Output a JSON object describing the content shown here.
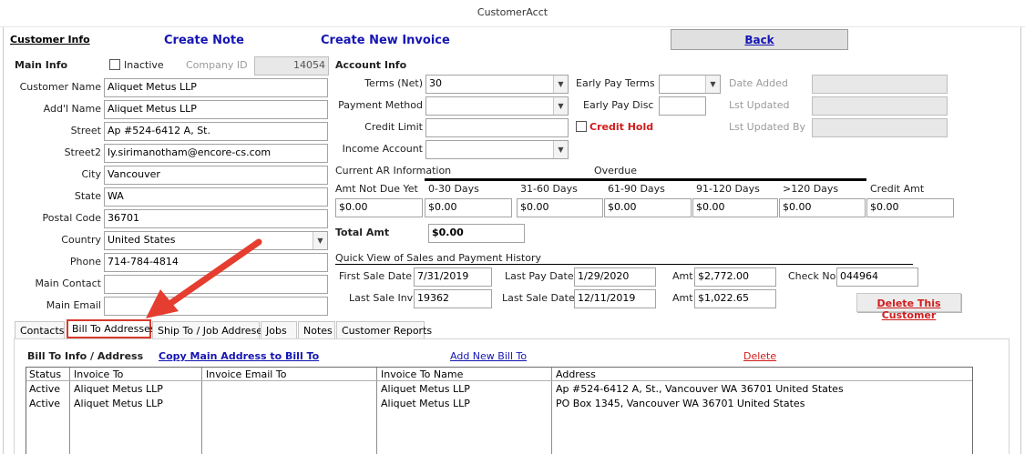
{
  "window": {
    "title": "CustomerAcct"
  },
  "header": {
    "customer_info": "Customer Info",
    "create_note": "Create Note",
    "create_invoice": "Create New Invoice",
    "back": "Back"
  },
  "main_info": {
    "heading": "Main Info",
    "inactive_label": "Inactive",
    "inactive_checked": false,
    "company_id_label": "Company ID",
    "company_id": "14054",
    "fields": [
      {
        "label": "Customer Name",
        "value": "Aliquet Metus LLP"
      },
      {
        "label": "Add'l Name",
        "value": "Aliquet Metus LLP"
      },
      {
        "label": "Street",
        "value": "Ap #524-6412 A, St."
      },
      {
        "label": "Street2",
        "value": "ly.sirimanotham@encore-cs.com"
      },
      {
        "label": "City",
        "value": "Vancouver"
      },
      {
        "label": "State",
        "value": "WA"
      },
      {
        "label": "Postal Code",
        "value": "36701"
      },
      {
        "label": "Country",
        "value": "United States"
      },
      {
        "label": "Phone",
        "value": "714-784-4814"
      },
      {
        "label": "Main Contact",
        "value": ""
      },
      {
        "label": "Main Email",
        "value": ""
      }
    ]
  },
  "account_info": {
    "heading": "Account Info",
    "terms_label": "Terms (Net)",
    "terms_value": "30",
    "payment_method_label": "Payment Method",
    "payment_method_value": "",
    "credit_limit_label": "Credit Limit",
    "credit_limit_value": "",
    "income_account_label": "Income Account",
    "income_account_value": "",
    "early_pay_terms_label": "Early Pay Terms",
    "early_pay_terms_value": "",
    "early_pay_disc_label": "Early Pay Disc",
    "early_pay_disc_value": "",
    "credit_hold_label": "Credit Hold",
    "credit_hold_checked": false,
    "date_added_label": "Date Added",
    "date_added_value": "",
    "lst_updated_label": "Lst Updated",
    "lst_updated_value": "",
    "lst_updated_by_label": "Lst Updated By",
    "lst_updated_by_value": ""
  },
  "ar": {
    "heading": "Current AR Information",
    "overdue_label": "Overdue",
    "columns": [
      "Amt Not Due Yet",
      "0-30 Days",
      "31-60 Days",
      "61-90 Days",
      "91-120 Days",
      ">120 Days",
      "Credit Amt"
    ],
    "values": [
      "$0.00",
      "$0.00",
      "$0.00",
      "$0.00",
      "$0.00",
      "$0.00",
      "$0.00"
    ],
    "total_label": "Total Amt",
    "total_value": "$0.00"
  },
  "history": {
    "heading": "Quick View of Sales and Payment History",
    "first_sale_date_label": "First Sale Date",
    "first_sale_date": "7/31/2019",
    "last_pay_date_label": "Last Pay Date",
    "last_pay_date": "1/29/2020",
    "amt_label_1": "Amt",
    "amt_1": "$2,772.00",
    "check_no_label": "Check No",
    "check_no": "044964",
    "last_sale_inv_label": "Last Sale Inv",
    "last_sale_inv": "19362",
    "last_sale_date_label": "Last Sale Date",
    "last_sale_date": "12/11/2019",
    "amt_label_2": "Amt",
    "amt_2": "$1,022.65",
    "delete_customer": "Delete This Customer"
  },
  "tabs": [
    {
      "label": "Contacts",
      "active": false
    },
    {
      "label": "Bill To Addresses",
      "active": true
    },
    {
      "label": "Ship To / Job Addreses",
      "active": false
    },
    {
      "label": "Jobs",
      "active": false
    },
    {
      "label": "Notes",
      "active": false
    },
    {
      "label": "Customer Reports",
      "active": false
    }
  ],
  "bill_to": {
    "heading": "Bill To Info / Address",
    "copy_main": "Copy Main Address to Bill To",
    "add_new": "Add New Bill To",
    "delete": "Delete",
    "columns": [
      "Status",
      "Invoice To",
      "Invoice Email To",
      "Invoice To Name",
      "Address"
    ],
    "rows": [
      [
        "Active",
        "Aliquet Metus LLP",
        "",
        "Aliquet Metus LLP",
        "Ap #524-6412 A, St., Vancouver WA  36701 United States"
      ],
      [
        "Active",
        "Aliquet Metus LLP",
        "",
        "Aliquet Metus LLP",
        "PO Box 1345, Vancouver WA  36701 United States"
      ]
    ]
  },
  "colors": {
    "link_blue": "#1515b3",
    "alert_red": "#d01c1c",
    "annotation_red": "#e53d2f"
  }
}
